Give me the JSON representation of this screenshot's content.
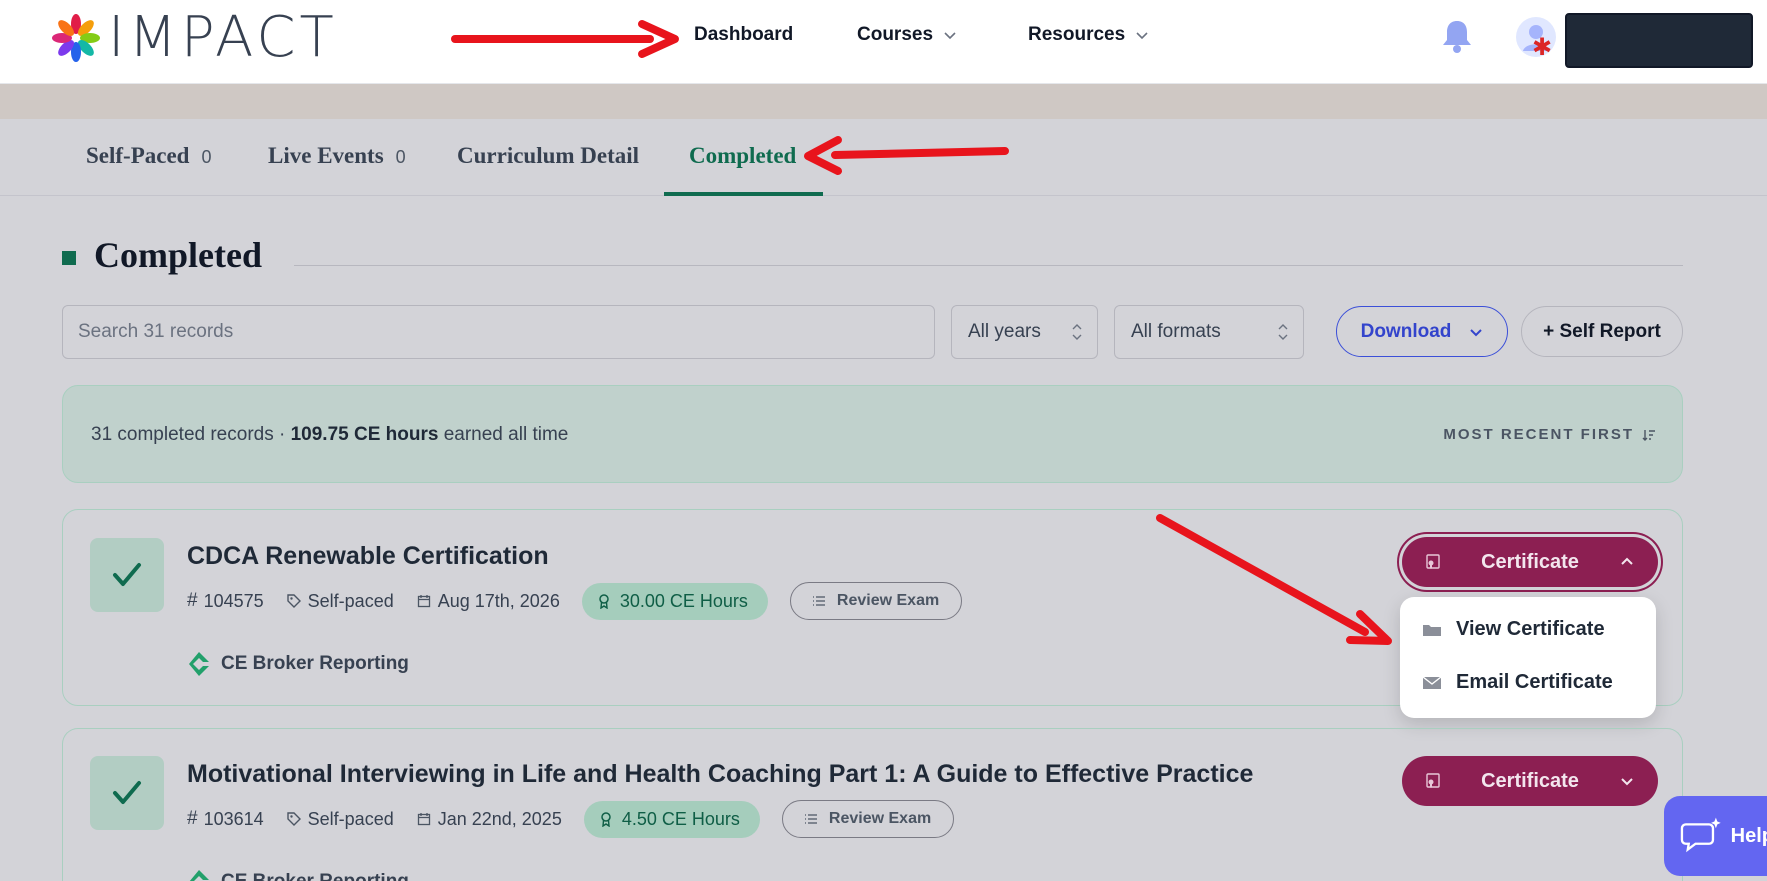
{
  "brand": {
    "name": "IMPACT"
  },
  "nav": {
    "dashboard": "Dashboard",
    "courses": "Courses",
    "resources": "Resources"
  },
  "tabs": [
    {
      "label": "Self-Paced",
      "count": "0"
    },
    {
      "label": "Live Events",
      "count": "0"
    },
    {
      "label": "Curriculum Detail",
      "count": ""
    },
    {
      "label": "Completed",
      "count": ""
    }
  ],
  "section": {
    "title": "Completed"
  },
  "filters": {
    "search_placeholder": "Search 31 records",
    "years": "All years",
    "formats": "All formats",
    "download": "Download",
    "self_report": "+ Self Report"
  },
  "summary": {
    "prefix": "31 completed records · ",
    "hours": "109.75 CE hours",
    "suffix": " earned all time",
    "sort": "MOST RECENT FIRST"
  },
  "records": [
    {
      "title": "CDCA Renewable Certification",
      "id": "104575",
      "format": "Self-paced",
      "date": "Aug 17th, 2026",
      "hours": "30.00 CE Hours",
      "review": "Review Exam",
      "reporting": "CE Broker Reporting",
      "certificate": "Certificate"
    },
    {
      "title": "Motivational Interviewing in Life and Health Coaching Part 1: A Guide to Effective Practice",
      "id": "103614",
      "format": "Self-paced",
      "date": "Jan 22nd, 2025",
      "hours": "4.50 CE Hours",
      "review": "Review Exam",
      "reporting": "CE Broker Reporting",
      "certificate": "Certificate"
    }
  ],
  "certificate_menu": {
    "view": "View Certificate",
    "email": "Email Certificate"
  },
  "help": {
    "label": "Help"
  },
  "colors": {
    "accent_green": "#0f6b4f",
    "certificate_purple": "#8c1f52",
    "download_blue": "#3344cc",
    "annotation_red": "#e8141c"
  }
}
